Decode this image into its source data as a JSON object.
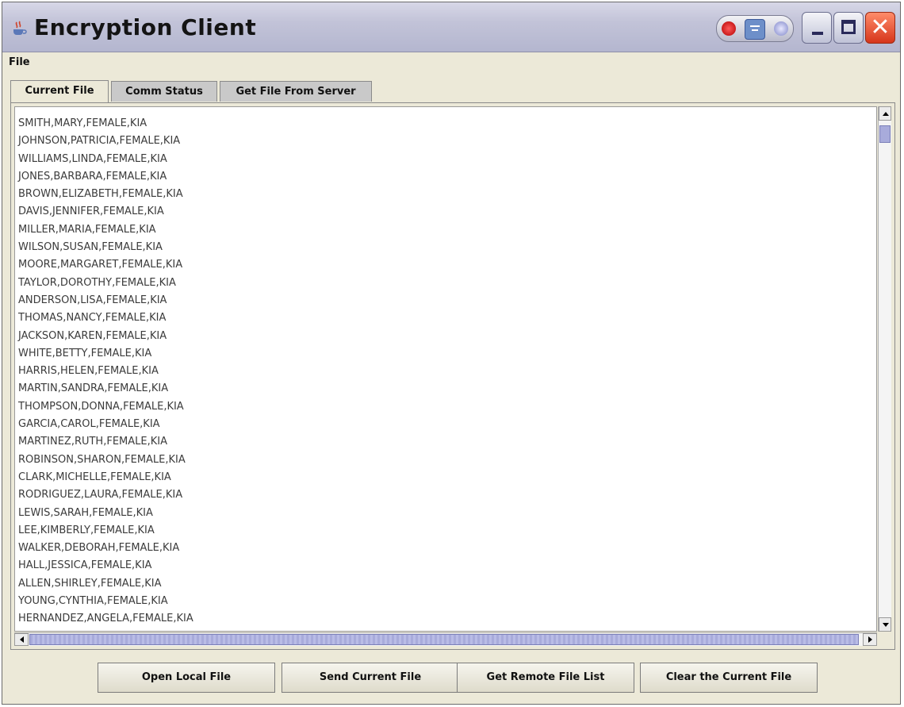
{
  "window": {
    "title": "Encryption Client",
    "icon": "java-cup-icon",
    "controls": [
      "minimize-button",
      "maximize-button",
      "close-button"
    ]
  },
  "menubar": {
    "file_label": "File"
  },
  "tabs": [
    {
      "label": "Current File",
      "active": true
    },
    {
      "label": "Comm Status",
      "active": false
    },
    {
      "label": "Get File From Server",
      "active": false
    }
  ],
  "file_content": {
    "lines": [
      "SMITH,MARY,FEMALE,KIA",
      "JOHNSON,PATRICIA,FEMALE,KIA",
      "WILLIAMS,LINDA,FEMALE,KIA",
      "JONES,BARBARA,FEMALE,KIA",
      "BROWN,ELIZABETH,FEMALE,KIA",
      "DAVIS,JENNIFER,FEMALE,KIA",
      "MILLER,MARIA,FEMALE,KIA",
      "WILSON,SUSAN,FEMALE,KIA",
      "MOORE,MARGARET,FEMALE,KIA",
      "TAYLOR,DOROTHY,FEMALE,KIA",
      "ANDERSON,LISA,FEMALE,KIA",
      "THOMAS,NANCY,FEMALE,KIA",
      "JACKSON,KAREN,FEMALE,KIA",
      "WHITE,BETTY,FEMALE,KIA",
      "HARRIS,HELEN,FEMALE,KIA",
      "MARTIN,SANDRA,FEMALE,KIA",
      "THOMPSON,DONNA,FEMALE,KIA",
      "GARCIA,CAROL,FEMALE,KIA",
      "MARTINEZ,RUTH,FEMALE,KIA",
      "ROBINSON,SHARON,FEMALE,KIA",
      "CLARK,MICHELLE,FEMALE,KIA",
      "RODRIGUEZ,LAURA,FEMALE,KIA",
      "LEWIS,SARAH,FEMALE,KIA",
      "LEE,KIMBERLY,FEMALE,KIA",
      "WALKER,DEBORAH,FEMALE,KIA",
      "HALL,JESSICA,FEMALE,KIA",
      "ALLEN,SHIRLEY,FEMALE,KIA",
      "YOUNG,CYNTHIA,FEMALE,KIA",
      "HERNANDEZ,ANGELA,FEMALE,KIA"
    ]
  },
  "buttons": {
    "open_local": "Open Local File",
    "send_current": "Send Current File",
    "get_remote_list": "Get Remote File List",
    "clear_current": "Clear the Current File"
  },
  "colors": {
    "titlebar": "#c2c3d8",
    "window_bg": "#ece9d8",
    "scroll_thumb": "#a8abdb",
    "close_button": "#d6351b"
  }
}
